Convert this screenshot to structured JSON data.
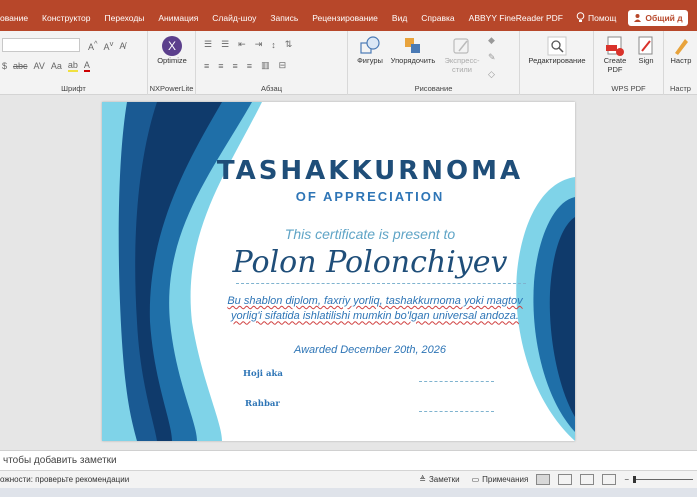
{
  "tabs": [
    "ование",
    "Конструктор",
    "Переходы",
    "Анимация",
    "Слайд-шоу",
    "Запись",
    "Рецензирование",
    "Вид",
    "Справка",
    "ABBYY FineReader PDF"
  ],
  "help_label": "Помощ",
  "share_label": "Общий д",
  "ribbon": {
    "font_group": "Шрифт",
    "nx": {
      "button": "Optimize",
      "group": "NXPowerLite"
    },
    "paragraph_group": "Абзац",
    "drawing": {
      "shapes": "Фигуры",
      "arrange": "Упорядочить",
      "styles": "Экспресс-стили",
      "group": "Рисование"
    },
    "editing": "Редактирование",
    "wps": {
      "create_pdf": "Create PDF",
      "sign": "Sign",
      "group": "WPS PDF"
    },
    "settings": {
      "label": "Настр",
      "group": "Настр"
    }
  },
  "certificate": {
    "title": "TASHAKKURNOMA",
    "subtitle": "OF APPRECIATION",
    "present": "This certificate is present to",
    "name": "Polon Polonchiyev",
    "body": "Bu shablon diplom, faxriy yorliq, tashakkurnoma yoki magtov yorlig'i sifatida ishlatilishi mumkin bo'lgan universal andoza.",
    "date": "Awarded December 20th, 2026",
    "sig1": "Hoji aka",
    "sig2": "Rahbar"
  },
  "notes_placeholder": "чтобы добавить заметки",
  "status": {
    "accessibility": "ожности: проверьте рекомендации",
    "notes": "Заметки",
    "comments": "Примечания"
  },
  "colors": {
    "accent": "#b7472a",
    "navy": "#1f4e79",
    "blue": "#2e75b6",
    "cyan": "#7fd3e8"
  }
}
